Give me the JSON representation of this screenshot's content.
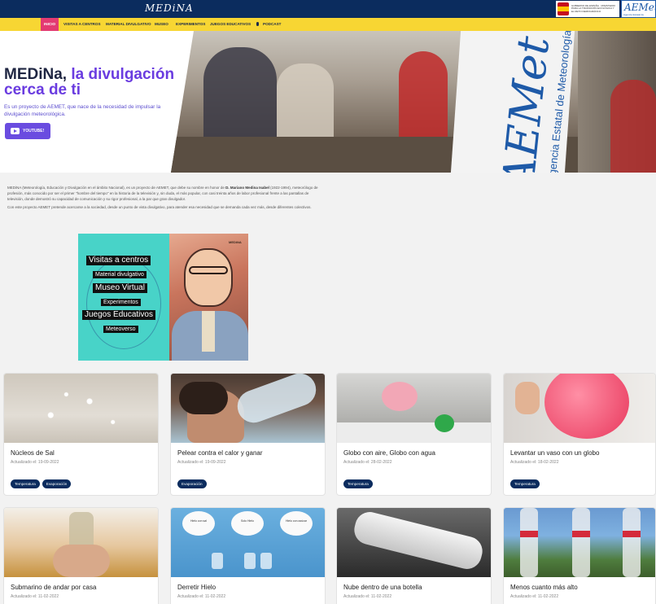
{
  "header": {
    "logo_text": "MEDiNA",
    "gov_text": "GOBIERNO DE ESPAÑA · MINISTERIO PARA LA TRANSICIÓN ECOLÓGICA Y EL RETO DEMOGRÁFICO",
    "aemet_text": "AEMet",
    "aemet_sub": "Agencia Estatal de Meteorología"
  },
  "nav": {
    "items": [
      {
        "label": "Inicio",
        "active": true
      },
      {
        "label": "Visitas a centros"
      },
      {
        "label": "Material divulgativo"
      },
      {
        "label": "Museo"
      },
      {
        "label": "Experimentos"
      },
      {
        "label": "Juegos educativos"
      },
      {
        "label": "Podcast"
      }
    ]
  },
  "hero": {
    "title_part1": "MEDiNa,",
    "title_part2": " la divulgación cerca de ti",
    "description": "Es un proyecto de AEMET, que nace de la necesidad de impulsar la divulgación meteorológica.",
    "button_label": "YOUTUBE!",
    "photo_banner": "AEMet",
    "photo_banner_sub": "Agencia Estatal de Meteorología"
  },
  "intro": {
    "p1_a": "MEDiNA (Meteorología, Educación y Divulgación en el ámbito Nacional), es un proyecto de AEMET, que debe su nombre en honor de ",
    "p1_b": "D. Mariano Medina Isabel",
    "p1_c": " (1922-1994), meteorólogo de profesión, más conocido por ser el primer \"hombre del tiempo\" en la historia de la televisión y, sin duda, el más popular, con casi treinta años de labor profesional frente a las pantallas de televisión, donde demostró su capacidad de comunicación y su rigor profesional, a la par que gran divulgador.",
    "p2": "Con este proyecto AEMET pretende acercarse a la sociedad, desde un punto de vista divulgativo, para atender esa necesidad que se demanda cada vez más, desde diferentes colectivos."
  },
  "promo": {
    "tags": [
      "Visitas a centros",
      "Material divulgativo",
      "Museo Virtual",
      "Experimentos",
      "Juegos Educativos",
      "Meteoverso"
    ],
    "watermark": "MEDiNA"
  },
  "cards": [
    {
      "title": "Núcleos de Sal",
      "date": "Actualizado el: 19-09-2022",
      "tags": [
        "Temperatura",
        "Evaporación"
      ]
    },
    {
      "title": "Pelear contra el calor y ganar",
      "date": "Actualizado el: 19-09-2022",
      "tags": [
        "Evaporación"
      ]
    },
    {
      "title": "Globo con aire, Globo con agua",
      "date": "Actualizado el: 28-02-2022",
      "tags": [
        "Temperatura"
      ]
    },
    {
      "title": "Levantar un vaso con un globo",
      "date": "Actualizado el: 18-02-2022",
      "tags": [
        "Temperatura"
      ]
    },
    {
      "title": "Submarino de andar por casa",
      "date": "Actualizado el: 11-02-2022",
      "tags": []
    },
    {
      "title": "Derretir Hielo",
      "date": "Actualizado el: 11-02-2022",
      "tags": []
    },
    {
      "title": "Nube dentro de una botella",
      "date": "Actualizado el: 11-02-2022",
      "tags": []
    },
    {
      "title": "Menos cuanto más alto",
      "date": "Actualizado el: 11-02-2022",
      "tags": []
    }
  ],
  "ice_labels": [
    "Hielo con sal",
    "Solo Hielo",
    "Hielo con azúcar"
  ]
}
